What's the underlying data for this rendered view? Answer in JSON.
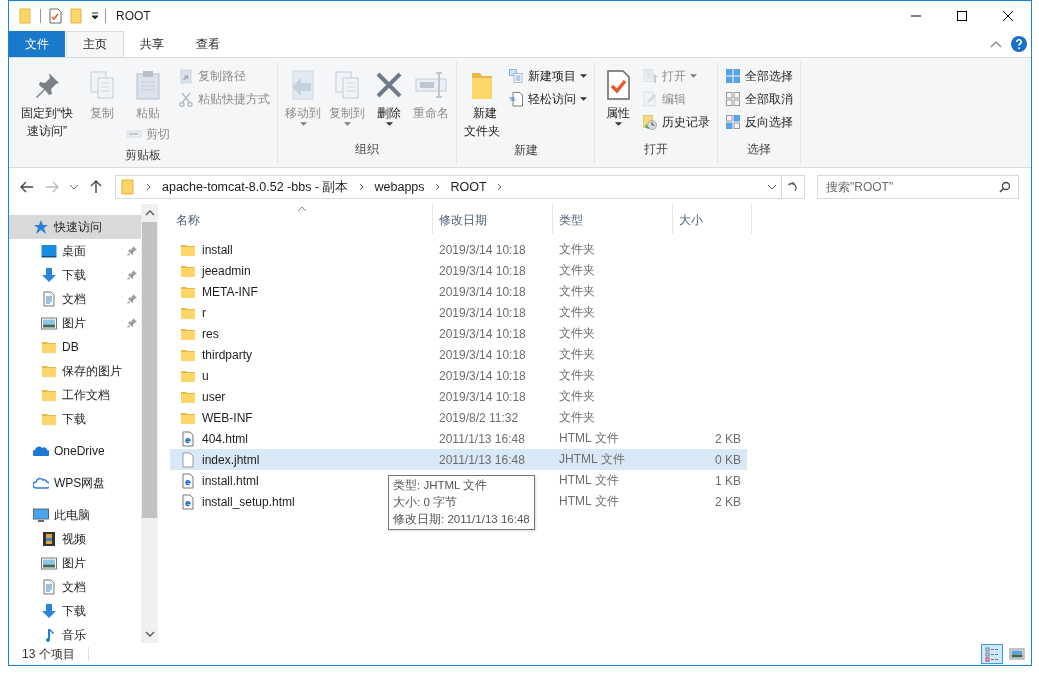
{
  "window": {
    "title": "ROOT"
  },
  "tabs": [
    {
      "label": "文件",
      "kind": "file",
      "selected": false
    },
    {
      "label": "主页",
      "kind": "tab",
      "selected": true
    },
    {
      "label": "共享",
      "kind": "tab",
      "selected": false
    },
    {
      "label": "查看",
      "kind": "tab",
      "selected": false
    }
  ],
  "ribbon": {
    "groups": [
      {
        "label": "剪贴板",
        "columns": [
          [
            {
              "kind": "large",
              "label": "固定到“快速访问”",
              "disabled": false,
              "menu": false
            }
          ],
          [
            {
              "kind": "large",
              "label": "复制",
              "disabled": true,
              "menu": false
            }
          ],
          [
            {
              "kind": "large",
              "label": "粘贴",
              "disabled": true,
              "menu": false
            },
            {
              "kind": "small",
              "label": "剪切",
              "disabled": true,
              "menu": false
            }
          ],
          [
            {
              "kind": "small",
              "label": "复制路径",
              "disabled": true,
              "menu": false
            },
            {
              "kind": "small",
              "label": "粘贴快捷方式",
              "disabled": true,
              "menu": false
            }
          ]
        ]
      },
      {
        "label": "组织",
        "columns": [
          [
            {
              "kind": "large",
              "label": "移动到",
              "disabled": true,
              "menu": true
            }
          ],
          [
            {
              "kind": "large",
              "label": "复制到",
              "disabled": true,
              "menu": true
            }
          ],
          [
            {
              "kind": "large",
              "label": "删除",
              "disabled": false,
              "menu": true
            }
          ],
          [
            {
              "kind": "large",
              "label": "重命名",
              "disabled": true,
              "menu": false
            }
          ]
        ]
      },
      {
        "label": "新建",
        "columns": [
          [
            {
              "kind": "large",
              "label": "新建文件夹",
              "disabled": false,
              "menu": false
            }
          ],
          [
            {
              "kind": "small",
              "label": "新建项目",
              "disabled": false,
              "menu": true
            },
            {
              "kind": "small",
              "label": "轻松访问",
              "disabled": false,
              "menu": true
            }
          ]
        ]
      },
      {
        "label": "打开",
        "columns": [
          [
            {
              "kind": "large",
              "label": "属性",
              "disabled": false,
              "menu": true
            }
          ],
          [
            {
              "kind": "small",
              "label": "打开",
              "disabled": true,
              "menu": true
            },
            {
              "kind": "small",
              "label": "编辑",
              "disabled": true,
              "menu": false
            },
            {
              "kind": "small",
              "label": "历史记录",
              "disabled": false,
              "menu": false
            }
          ]
        ]
      },
      {
        "label": "选择",
        "columns": [
          [
            {
              "kind": "small",
              "label": "全部选择",
              "disabled": false,
              "menu": false
            },
            {
              "kind": "small",
              "label": "全部取消",
              "disabled": false,
              "menu": false
            },
            {
              "kind": "small",
              "label": "反向选择",
              "disabled": false,
              "menu": false
            }
          ]
        ]
      }
    ]
  },
  "address": {
    "breadcrumbs": [
      "apache-tomcat-8.0.52 -bbs - 副本",
      "webapps",
      "ROOT"
    ]
  },
  "search": {
    "placeholder": "搜索\"ROOT\""
  },
  "nav": {
    "items": [
      {
        "label": "快速访问",
        "kind": "star",
        "selected": true,
        "children": [
          {
            "label": "桌面",
            "kind": "desktop",
            "pinned": true,
            "selected": false
          },
          {
            "label": "下载",
            "kind": "download",
            "pinned": true,
            "selected": false
          },
          {
            "label": "文档",
            "kind": "document",
            "pinned": true,
            "selected": false
          },
          {
            "label": "图片",
            "kind": "pictures",
            "pinned": true,
            "selected": false
          },
          {
            "label": "DB",
            "kind": "folder",
            "pinned": false,
            "selected": false
          },
          {
            "label": "保存的图片",
            "kind": "folder",
            "pinned": false,
            "selected": false
          },
          {
            "label": "工作文档",
            "kind": "folder",
            "pinned": false,
            "selected": false
          },
          {
            "label": "下载",
            "kind": "folder",
            "pinned": false,
            "selected": false
          }
        ]
      },
      {
        "label": "OneDrive",
        "kind": "cloud",
        "selected": false
      },
      {
        "label": "WPS网盘",
        "kind": "cloud-outline",
        "selected": false
      },
      {
        "label": "此电脑",
        "kind": "pc",
        "selected": false,
        "children": [
          {
            "label": "视频",
            "kind": "video",
            "pinned": false,
            "selected": false
          },
          {
            "label": "图片",
            "kind": "pictures",
            "pinned": false,
            "selected": false
          },
          {
            "label": "文档",
            "kind": "document",
            "pinned": false,
            "selected": false
          },
          {
            "label": "下载",
            "kind": "download",
            "pinned": false,
            "selected": false
          },
          {
            "label": "音乐",
            "kind": "music",
            "pinned": false,
            "selected": false
          }
        ]
      }
    ]
  },
  "table": {
    "columns": [
      "名称",
      "修改日期",
      "类型",
      "大小"
    ],
    "rows": [
      {
        "name": "install",
        "kind": "folder",
        "date": "2019/3/14 10:18",
        "type": "文件夹",
        "selected": false
      },
      {
        "name": "jeeadmin",
        "kind": "folder",
        "date": "2019/3/14 10:18",
        "type": "文件夹",
        "selected": false
      },
      {
        "name": "META-INF",
        "kind": "folder",
        "date": "2019/3/14 10:18",
        "type": "文件夹",
        "selected": false
      },
      {
        "name": "r",
        "kind": "folder",
        "date": "2019/3/14 10:18",
        "type": "文件夹",
        "selected": false
      },
      {
        "name": "res",
        "kind": "folder",
        "date": "2019/3/14 10:18",
        "type": "文件夹",
        "selected": false
      },
      {
        "name": "thirdparty",
        "kind": "folder",
        "date": "2019/3/14 10:18",
        "type": "文件夹",
        "selected": false
      },
      {
        "name": "u",
        "kind": "folder",
        "date": "2019/3/14 10:18",
        "type": "文件夹",
        "selected": false
      },
      {
        "name": "user",
        "kind": "folder",
        "date": "2019/3/14 10:18",
        "type": "文件夹",
        "selected": false
      },
      {
        "name": "WEB-INF",
        "kind": "folder",
        "date": "2019/8/2 11:32",
        "type": "文件夹",
        "selected": false
      },
      {
        "name": "404.html",
        "kind": "html",
        "date": "2011/1/13 16:48",
        "type": "HTML 文件",
        "size": "2 KB",
        "selected": false
      },
      {
        "name": "index.jhtml",
        "kind": "file",
        "date": "2011/1/13 16:48",
        "type": "JHTML 文件",
        "size": "0 KB",
        "selected": true
      },
      {
        "name": "install.html",
        "kind": "html",
        "type": "HTML 文件",
        "size": "1 KB",
        "selected": false
      },
      {
        "name": "install_setup.html",
        "kind": "html",
        "type": "HTML 文件",
        "size": "2 KB",
        "selected": false
      }
    ]
  },
  "tooltip": {
    "lines": [
      "类型: JHTML 文件",
      "大小: 0 字节",
      "修改日期: 2011/1/13 16:48"
    ]
  },
  "status_bar": {
    "text": "13 个项目",
    "views": [
      {
        "kind": "details",
        "selected": true
      },
      {
        "kind": "large-icons",
        "selected": false
      }
    ]
  }
}
